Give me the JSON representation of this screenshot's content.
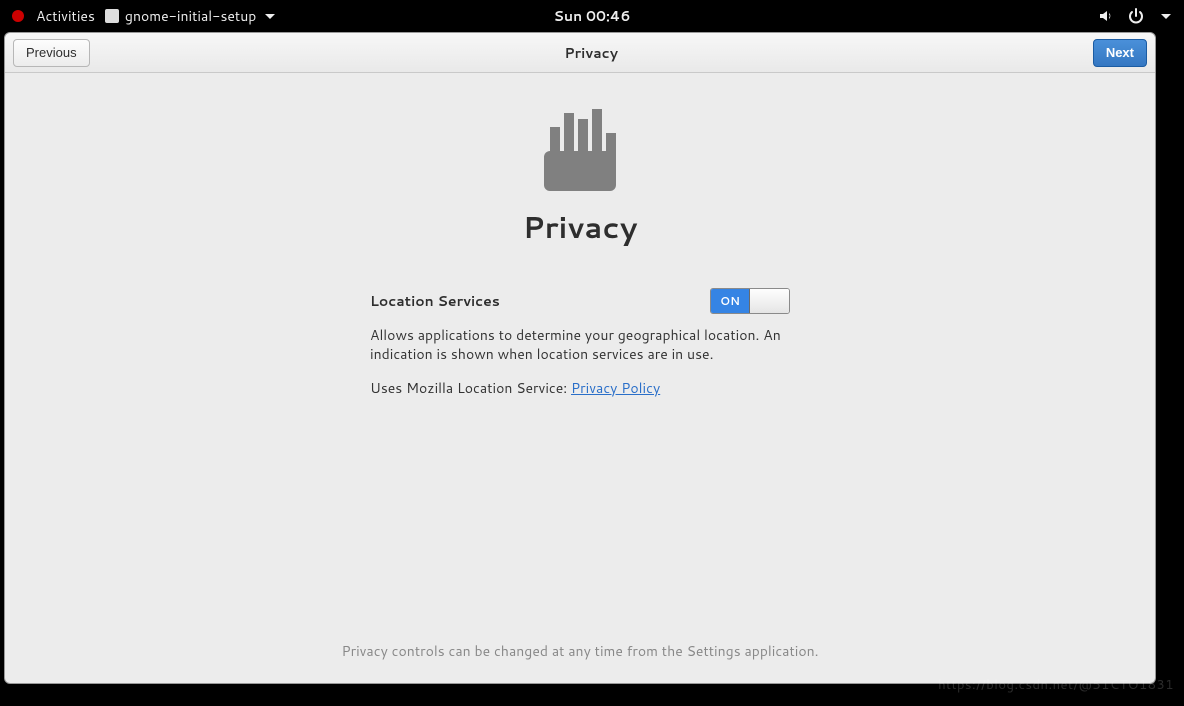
{
  "topbar": {
    "activities": "Activities",
    "app_name": "gnome-initial-setup",
    "clock": "Sun 00:46"
  },
  "headerbar": {
    "previous": "Previous",
    "title": "Privacy",
    "next": "Next"
  },
  "page": {
    "title": "Privacy",
    "location": {
      "label": "Location Services",
      "switch_state": "ON",
      "description": "Allows applications to determine your geographical location. An indication is shown when location services are in use.",
      "uses_prefix": "Uses Mozilla Location Service: ",
      "policy_link_text": "Privacy Policy"
    },
    "footer": "Privacy controls can be changed at any time from the Settings application."
  },
  "watermark": "https://blog.csdn.net/@51CTO1831"
}
